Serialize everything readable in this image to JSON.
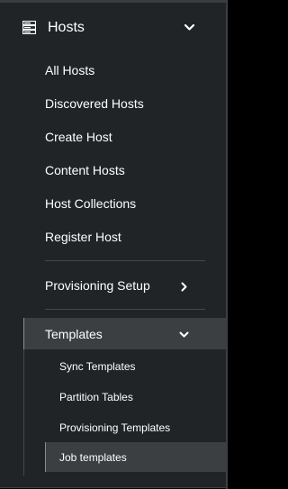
{
  "colors": {
    "panel_bg": "#212427",
    "active_bg": "#3c3f42",
    "text": "#ffffff",
    "divider": "#46494c"
  },
  "hosts_section": {
    "title": "Hosts",
    "icon": "server-stack-icon",
    "expanded": true,
    "items": [
      {
        "label": "All Hosts"
      },
      {
        "label": "Discovered Hosts"
      },
      {
        "label": "Create Host"
      },
      {
        "label": "Content Hosts"
      },
      {
        "label": "Host Collections"
      },
      {
        "label": "Register Host"
      }
    ]
  },
  "provisioning_setup": {
    "label": "Provisioning Setup",
    "expanded": false
  },
  "templates": {
    "label": "Templates",
    "expanded": true,
    "items": [
      {
        "label": "Sync Templates"
      },
      {
        "label": "Partition Tables"
      },
      {
        "label": "Provisioning Templates"
      },
      {
        "label": "Job templates",
        "active": true
      }
    ]
  }
}
